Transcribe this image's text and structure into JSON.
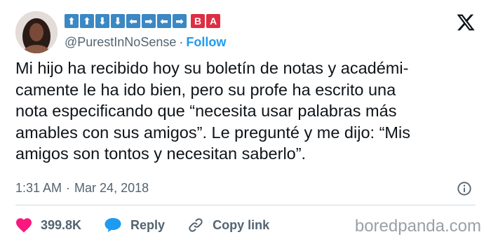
{
  "tweet": {
    "display_name_keys": [
      {
        "glyph": "⬆",
        "kind": "arrow",
        "icon": "up-arrow-key-icon"
      },
      {
        "glyph": "⬆",
        "kind": "arrow",
        "icon": "up-arrow-key-icon"
      },
      {
        "glyph": "⬇",
        "kind": "arrow",
        "icon": "down-arrow-key-icon"
      },
      {
        "glyph": "⬇",
        "kind": "arrow",
        "icon": "down-arrow-key-icon"
      },
      {
        "glyph": "⬅",
        "kind": "arrow",
        "icon": "left-arrow-key-icon"
      },
      {
        "glyph": "➡",
        "kind": "arrow",
        "icon": "right-arrow-key-icon"
      },
      {
        "glyph": "⬅",
        "kind": "arrow",
        "icon": "left-arrow-key-icon"
      },
      {
        "glyph": "➡",
        "kind": "arrow",
        "icon": "right-arrow-key-icon"
      },
      {
        "glyph": "B",
        "kind": "letter",
        "icon": "b-button-key-icon"
      },
      {
        "glyph": "A",
        "kind": "letter",
        "icon": "a-button-key-icon"
      }
    ],
    "handle": "@PurestInNoSense",
    "separator": "·",
    "follow_label": "Follow",
    "text_lines": [
      "Mi hijo ha recibido hoy su boletín de notas y académi-",
      "camente le ha ido bien, pero su profe ha escrito una",
      "nota especificando que “necesita usar palabras más",
      "amables con sus amigos”. Le pregunté y me dijo: “Mis",
      "amigos son tontos y necesitan saberlo”."
    ],
    "time": "1:31 AM",
    "date": "Mar 24, 2018",
    "likes": "399.8K",
    "reply_label": "Reply",
    "copy_link_label": "Copy link"
  },
  "watermark": "boredpanda.com",
  "colors": {
    "accent": "#1d9bf0",
    "like": "#f91880",
    "key_arrow": "#3b88c3",
    "key_letter": "#dd2e44",
    "muted_text": "#536471"
  },
  "icons": {
    "brand": "x-logo-icon",
    "info": "info-icon",
    "like": "heart-icon",
    "reply": "speech-bubble-icon",
    "copy_link": "link-icon"
  }
}
